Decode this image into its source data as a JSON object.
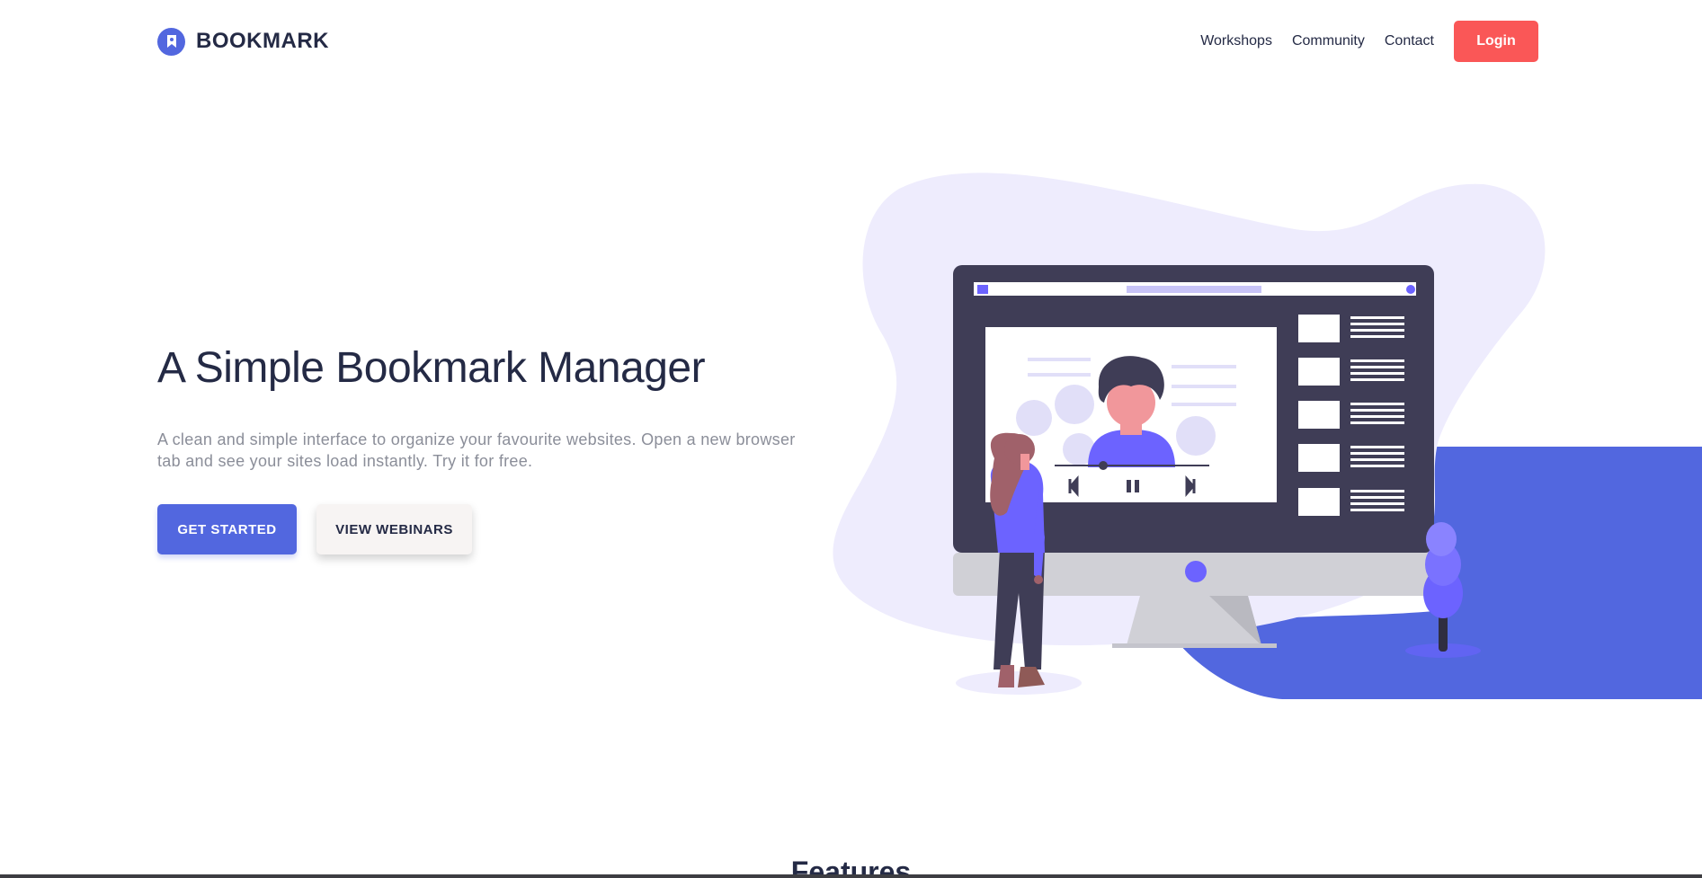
{
  "header": {
    "logo_text": "BOOKMARK",
    "nav": [
      "Workshops",
      "Community",
      "Contact"
    ],
    "login_label": "Login"
  },
  "hero": {
    "title": "A Simple Bookmark Manager",
    "description": "A clean and simple interface to organize your favourite websites. Open a new browser tab and see your sites load instantly. Try it for free.",
    "primary_label": "GET STARTED",
    "secondary_label": "VIEW WEBINARS"
  },
  "features": {
    "title": "Features"
  },
  "colors": {
    "primary": "#5267df",
    "accent": "#fa5757",
    "dark": "#242a45",
    "muted": "#8b8e99"
  },
  "icons": [
    "bookmark-logo-icon"
  ]
}
